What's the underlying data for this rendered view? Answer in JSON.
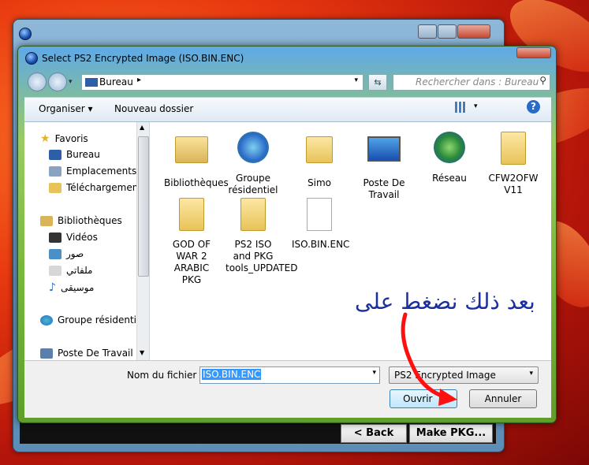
{
  "parent_window": {
    "back_button": "< Back",
    "make_button": "Make PKG..."
  },
  "dialog": {
    "title": "Select PS2 Encrypted Image (ISO.BIN.ENC)",
    "address": {
      "location": "Bureau"
    },
    "search_placeholder": "Rechercher dans : Bureau",
    "toolbar": {
      "organize": "Organiser ▾",
      "new_folder": "Nouveau dossier"
    },
    "nav": [
      {
        "label": "Favoris",
        "icon": "star-icon"
      },
      {
        "label": "Bureau",
        "icon": "desktop-icon"
      },
      {
        "label": "Emplacements ré",
        "icon": "recent-places-icon"
      },
      {
        "label": "Téléchargements",
        "icon": "downloads-icon"
      },
      {
        "label": "Bibliothèques",
        "icon": "libraries-icon"
      },
      {
        "label": "Vidéos",
        "icon": "videos-icon"
      },
      {
        "label": "صور",
        "icon": "pictures-icon"
      },
      {
        "label": "ملفاتي",
        "icon": "documents-icon"
      },
      {
        "label": "موسيقى",
        "icon": "music-icon"
      },
      {
        "label": "Groupe résidentiel",
        "icon": "homegroup-icon"
      },
      {
        "label": "Poste De Travail",
        "icon": "computer-icon"
      }
    ],
    "files": [
      {
        "label": "Bibliothèques",
        "icon": "libraries-icon"
      },
      {
        "label": "Groupe résidentiel",
        "icon": "homegroup-icon"
      },
      {
        "label": "Simo",
        "icon": "user-folder-icon"
      },
      {
        "label": "Poste De Travail",
        "icon": "computer-icon"
      },
      {
        "label": "Réseau",
        "icon": "network-icon"
      },
      {
        "label": "CFW2OFW V11",
        "icon": "folder-icon"
      },
      {
        "label": "GOD OF WAR 2 ARABIC PKG",
        "icon": "folder-icon"
      },
      {
        "label": "PS2 ISO and PKG tools_UPDATED",
        "icon": "folder-icon"
      },
      {
        "label": "ISO.BIN.ENC",
        "icon": "file-icon"
      }
    ],
    "filename_label": "Nom du fichier :",
    "filename_value": "ISO.BIN.ENC",
    "filetype_value": "PS2 Encrypted Image",
    "open_button": "Ouvrir",
    "cancel_button": "Annuler"
  },
  "annotation": {
    "text": "بعد ذلك نضغط على",
    "color": "#1a2fa0",
    "arrow_color": "#ff1010"
  }
}
